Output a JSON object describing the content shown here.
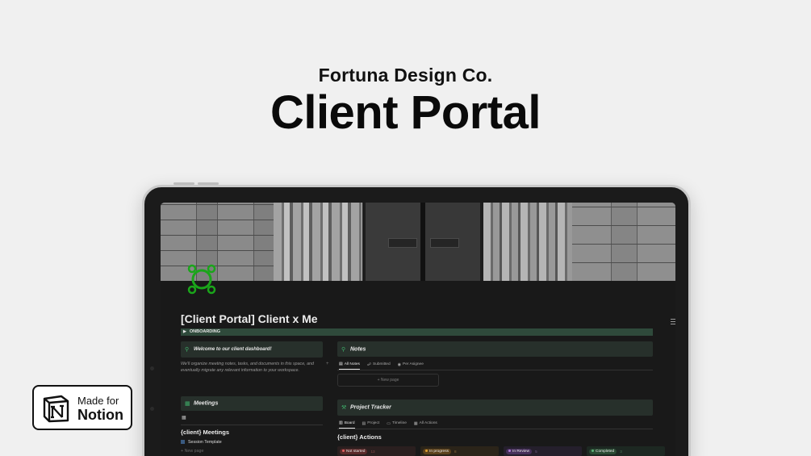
{
  "header": {
    "company": "Fortuna Design Co.",
    "title": "Client Portal"
  },
  "page": {
    "title": "[Client Portal] Client x Me",
    "toggle_label": "ONBOARDING"
  },
  "welcome": {
    "heading": "Welcome to our client dashboard!",
    "body": "We'll organize meeting notes, tasks, and documents in this space, and eventually migrate any relevant information to your workspace."
  },
  "notes": {
    "heading": "Notes",
    "tabs": [
      "All Notes",
      "Submitted",
      "Per Asignee"
    ],
    "new_page": "+ New page"
  },
  "meetings": {
    "heading": "Meetings",
    "db_title": "{client} Meetings",
    "rows": [
      "Session Template"
    ],
    "new_page": "+ New page"
  },
  "tracker": {
    "heading": "Project Tracker",
    "tabs": [
      "Board",
      "Project",
      "Timeline",
      "All Actions"
    ],
    "db_title": "{client} Actions",
    "statuses": [
      {
        "label": "Not started",
        "count": "13",
        "color": "#e06060",
        "bg": "#3a2323"
      },
      {
        "label": "In progress",
        "count": "8",
        "color": "#e0a030",
        "bg": "#3a2d1b"
      },
      {
        "label": "In Review",
        "count": "5",
        "color": "#b07cd8",
        "bg": "#2d2338"
      },
      {
        "label": "Completed",
        "count": "3",
        "color": "#5fb37a",
        "bg": "#1f3326"
      }
    ]
  },
  "badge": {
    "line1": "Made for",
    "line2": "Notion"
  },
  "colors": {
    "accent_green": "#2f4a3b",
    "icon_green": "#1aa51a"
  }
}
